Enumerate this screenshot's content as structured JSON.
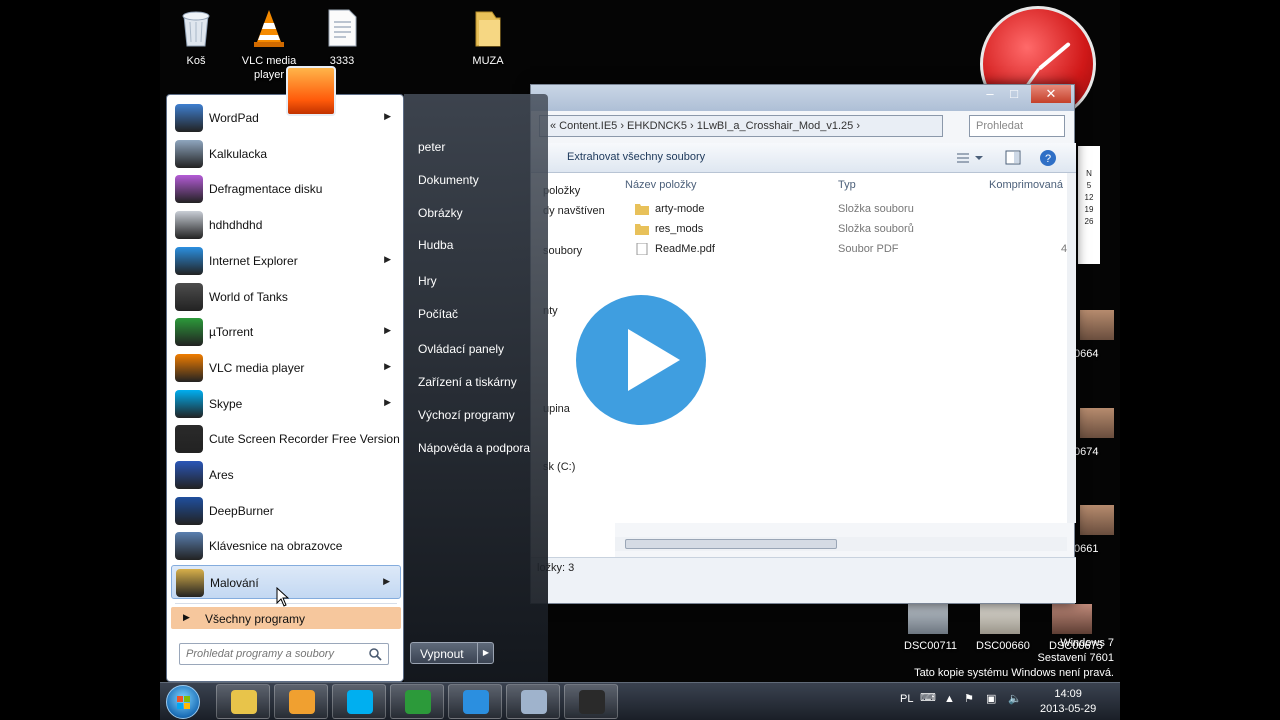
{
  "desktop": {
    "icons": [
      {
        "label": "Koš",
        "icon": "recycle-bin-icon"
      },
      {
        "label": "VLC media player",
        "icon": "vlc-cone-icon"
      },
      {
        "label": "3333",
        "icon": "document-icon"
      },
      {
        "label": "MUZA",
        "icon": "folder-icon"
      }
    ]
  },
  "explorer": {
    "address": "« Content.IE5 › EHKDNCK5 › 1LwBI_a_Crosshair_Mod_v1.25 ›",
    "search_placeholder": "Prohledat",
    "toolbar": {
      "extract_label": "Extrahovat všechny soubory"
    },
    "nav_items": [
      "položky",
      "dy navštíven",
      "soubory",
      "nty",
      "upina",
      "sk (C:)"
    ],
    "columns": {
      "name": "Název položky",
      "type": "Typ",
      "compressed": "Komprimovaná",
      "size_hint": "4"
    },
    "rows": [
      {
        "name": "arty-mode",
        "type": "Složka souboru",
        "icon": "folder-icon"
      },
      {
        "name": "res_mods",
        "type": "Složka souborů",
        "icon": "folder-icon"
      },
      {
        "name": "ReadMe.pdf",
        "type": "Soubor PDF",
        "icon": "pdf-file-icon"
      }
    ],
    "status": "ložky: 3",
    "window_buttons": {
      "minimize": "–",
      "maximize": "□",
      "close": "✕"
    }
  },
  "calendar": [
    "N",
    "5",
    "12",
    "19",
    "26"
  ],
  "thumbnails": [
    {
      "label": "0664"
    },
    {
      "label": "0674"
    },
    {
      "label": "0661"
    },
    {
      "label": "DSC00711"
    },
    {
      "label": "DSC00660"
    },
    {
      "label": "DSC00675"
    }
  ],
  "watermark": {
    "line1": "Windows 7",
    "line2": "Sestavení 7601",
    "line3": "Tato kopie systému Windows není pravá."
  },
  "start_menu": {
    "programs": [
      {
        "label": "WordPad",
        "submenu": true,
        "color": "#3f7fd0"
      },
      {
        "label": "Kalkulacka",
        "submenu": false,
        "color": "#8fa6bf"
      },
      {
        "label": "Defragmentace disku",
        "submenu": false,
        "color": "#b45bd6"
      },
      {
        "label": "hdhdhdhd",
        "submenu": false,
        "color": "#c9ced6"
      },
      {
        "label": "Internet Explorer",
        "submenu": true,
        "color": "#2b8fe0"
      },
      {
        "label": "World of Tanks",
        "submenu": false,
        "color": "#4d4d4d"
      },
      {
        "label": "µTorrent",
        "submenu": true,
        "color": "#2c9a3a"
      },
      {
        "label": "VLC media player",
        "submenu": true,
        "color": "#f07d00"
      },
      {
        "label": "Skype",
        "submenu": true,
        "color": "#00aff0"
      },
      {
        "label": "Cute Screen Recorder Free Version",
        "submenu": false,
        "color": "#2a2a2a"
      },
      {
        "label": "Ares",
        "submenu": false,
        "color": "#2a56b8"
      },
      {
        "label": "DeepBurner",
        "submenu": false,
        "color": "#1f4f9e"
      },
      {
        "label": "Klávesnice na obrazovce",
        "submenu": false,
        "color": "#5a7fb0"
      },
      {
        "label": "Malování",
        "submenu": true,
        "color": "#d8b04a"
      }
    ],
    "all_programs": "Všechny programy",
    "search_placeholder": "Prohledat programy a soubory",
    "right_items": [
      "peter",
      "Dokumenty",
      "Obrázky",
      "Hudba",
      "Hry",
      "Počítač",
      "Ovládací panely",
      "Zařízení a tiskárny",
      "Výchozí programy",
      "Nápověda a podpora"
    ],
    "shutdown": "Vypnout"
  },
  "taskbar": {
    "buttons": [
      {
        "name": "explorer",
        "color": "#e8c44a"
      },
      {
        "name": "media-player",
        "color": "#f0a030"
      },
      {
        "name": "skype",
        "color": "#00aff0"
      },
      {
        "name": "utorrent",
        "color": "#2c9a3a"
      },
      {
        "name": "internet-explorer",
        "color": "#2b8fe0"
      },
      {
        "name": "window",
        "color": "#9fb3cc"
      },
      {
        "name": "screen-recorder",
        "color": "#2a2a2a"
      }
    ],
    "lang": "PL",
    "time": "14:09",
    "date": "2013-05-29"
  }
}
